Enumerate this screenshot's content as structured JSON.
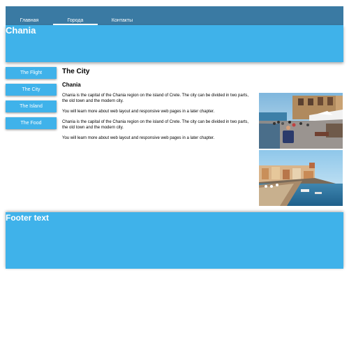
{
  "nav": {
    "tabs": [
      {
        "label": "Главная"
      },
      {
        "label": "Города",
        "active": true
      },
      {
        "label": "Контакты"
      }
    ]
  },
  "header": {
    "title": "Chania"
  },
  "menu": {
    "items": [
      {
        "label": "The Flight"
      },
      {
        "label": "The City"
      },
      {
        "label": "The Island"
      },
      {
        "label": "The Food"
      }
    ]
  },
  "main": {
    "title": "The City",
    "subtitle": "Chania",
    "paragraphs": [
      "Chania is the capital of the Chania region on the island of Crete. The city can be divided in two parts, the old town and the modern city.",
      "You will learn more about web layout and responsive web pages in a later chapter.",
      "Chania is the capital of the Chania region on the island of Crete. The city can be divided in two parts, the old town and the modern city.",
      "You will learn more about web layout and responsive web pages in a later chapter."
    ]
  },
  "footer": {
    "text": "Footer text"
  },
  "colors": {
    "nav_bar": "#3a7aa3",
    "accent": "#3fb2ea",
    "text_on_accent": "#ffffff"
  }
}
